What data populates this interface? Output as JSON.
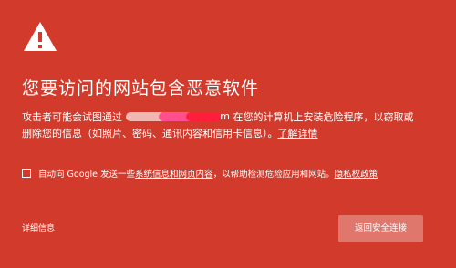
{
  "icon": "warning-triangle-icon",
  "title": "您要访问的网站包含恶意软件",
  "message": {
    "line1_prefix": "攻击者可能会试图通过",
    "domain_tail": "m",
    "line1_suffix": " 在您的计算机上安装危险程序，以窃取或",
    "line2_prefix": "删除您的信息（如照片、密码、通讯内容和信用卡信息）。",
    "learn_more": "了解详情"
  },
  "report": {
    "prefix": "自动向 Google 发送一些",
    "link_system_info": "系统信息和网页内容",
    "middle": "，以帮助检测危险应用和网站。",
    "link_privacy": "隐私权政策"
  },
  "details_label": "详细信息",
  "back_button_label": "返回安全连接",
  "colors": {
    "background": "#d23b2c",
    "text": "#ffffff",
    "button": "#e0776d",
    "redaction_light": "#f0b8b2",
    "redaction_pink": "#ff4f8f",
    "redaction_red": "#ff1f3d"
  }
}
